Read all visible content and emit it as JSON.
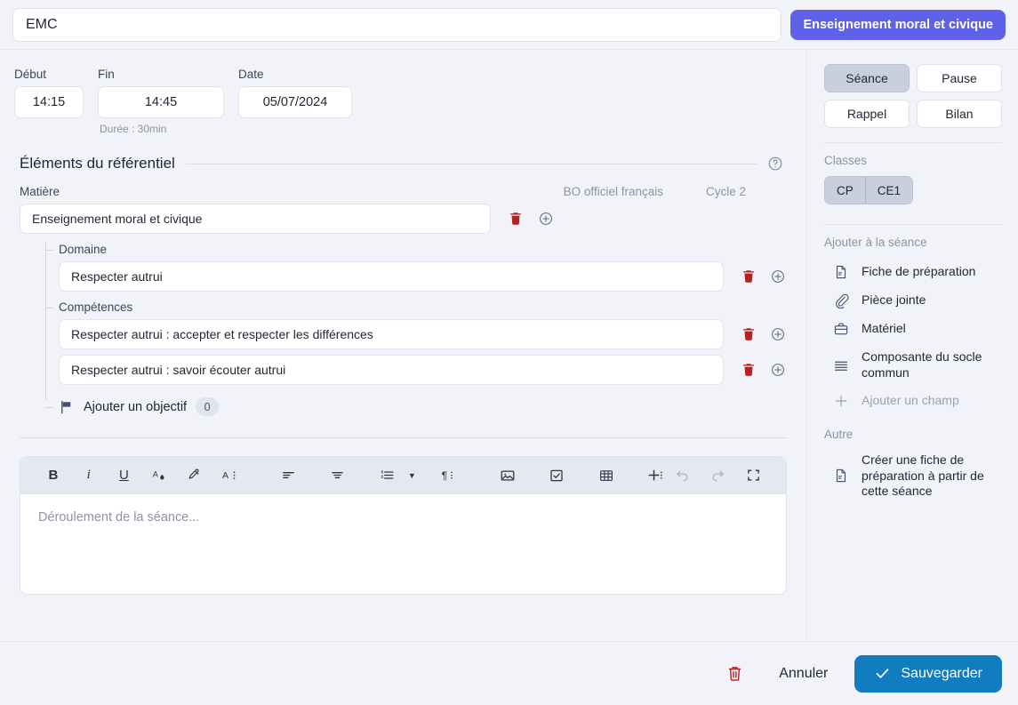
{
  "header": {
    "title_value": "EMC",
    "title_placeholder": "Titre",
    "subject_badge": "Enseignement moral et civique"
  },
  "schedule": {
    "start_label": "Début",
    "start_value": "14:15",
    "end_label": "Fin",
    "end_value": "14:45",
    "date_label": "Date",
    "date_value": "05/07/2024",
    "duration_text": "Durée : 30min"
  },
  "referentiel": {
    "section_title": "Éléments du référentiel",
    "help_icon": "question-circle-icon",
    "matiere_label": "Matière",
    "meta_source": "BO officiel français",
    "meta_cycle": "Cycle 2",
    "matiere_value": "Enseignement moral et civique",
    "domaine_label": "Domaine",
    "domaine_values": [
      "Respecter autrui"
    ],
    "competences_label": "Compétences",
    "competences_values": [
      "Respecter autrui : accepter et respecter les différences",
      "Respecter autrui : savoir écouter autrui"
    ],
    "objectif_label": "Ajouter un objectif",
    "objectif_count": "0",
    "objectif_icon": "flag-icon",
    "delete_icon": "trash-icon",
    "add_icon": "plus-circle-icon"
  },
  "editor": {
    "placeholder": "Déroulement de la séance...",
    "toolbar": [
      {
        "name": "bold-button",
        "glyph": "B"
      },
      {
        "name": "italic-button",
        "glyph": "i"
      },
      {
        "name": "underline-button",
        "glyph": "U"
      },
      {
        "name": "text-color-button",
        "glyph": "A"
      },
      {
        "name": "highlight-button",
        "glyph": "highlighter-icon"
      },
      {
        "name": "font-size-button",
        "glyph": "A"
      },
      {
        "name": "align-left-button",
        "glyph": "align-left-icon"
      },
      {
        "name": "align-center-button",
        "glyph": "align-center-icon"
      },
      {
        "name": "ordered-list-button",
        "glyph": "list-ordered-icon"
      },
      {
        "name": "list-dropdown-caret",
        "glyph": "chevron-down-icon"
      },
      {
        "name": "paragraph-button",
        "glyph": "pilcrow-icon"
      },
      {
        "name": "insert-image-button",
        "glyph": "image-icon"
      },
      {
        "name": "insert-checkbox-button",
        "glyph": "checkbox-icon"
      },
      {
        "name": "insert-table-button",
        "glyph": "table-icon"
      },
      {
        "name": "insert-more-button",
        "glyph": "plus-icon"
      },
      {
        "name": "undo-button",
        "glyph": "undo-icon"
      },
      {
        "name": "redo-button",
        "glyph": "redo-icon"
      },
      {
        "name": "fullscreen-button",
        "glyph": "fullscreen-icon"
      }
    ]
  },
  "sidebar": {
    "types": [
      {
        "label": "Séance",
        "active": true
      },
      {
        "label": "Pause",
        "active": false
      },
      {
        "label": "Rappel",
        "active": false
      },
      {
        "label": "Bilan",
        "active": false
      }
    ],
    "classes_label": "Classes",
    "classes": [
      {
        "label": "CP",
        "active": true
      },
      {
        "label": "CE1",
        "active": true
      }
    ],
    "add_section_label": "Ajouter à la séance",
    "add_items": [
      {
        "label": "Fiche de préparation",
        "icon": "document-icon",
        "muted": false
      },
      {
        "label": "Pièce jointe",
        "icon": "paperclip-icon",
        "muted": false
      },
      {
        "label": "Matériel",
        "icon": "briefcase-icon",
        "muted": false
      },
      {
        "label": "Composante du socle commun",
        "icon": "lines-icon",
        "muted": false
      },
      {
        "label": "Ajouter un champ",
        "icon": "plus-icon",
        "muted": true
      }
    ],
    "other_section_label": "Autre",
    "other_items": [
      {
        "label": "Créer une fiche de préparation à partir de cette séance",
        "icon": "document-icon"
      }
    ]
  },
  "footer": {
    "delete_icon": "trash-icon",
    "cancel_label": "Annuler",
    "save_label": "Sauvegarder",
    "save_icon": "check-icon"
  },
  "colors": {
    "background": "#f1f3f8",
    "accent_badge": "#5f62e8",
    "save_button": "#127cc1",
    "danger": "#b62020",
    "active_segment": "#c9d0db"
  }
}
